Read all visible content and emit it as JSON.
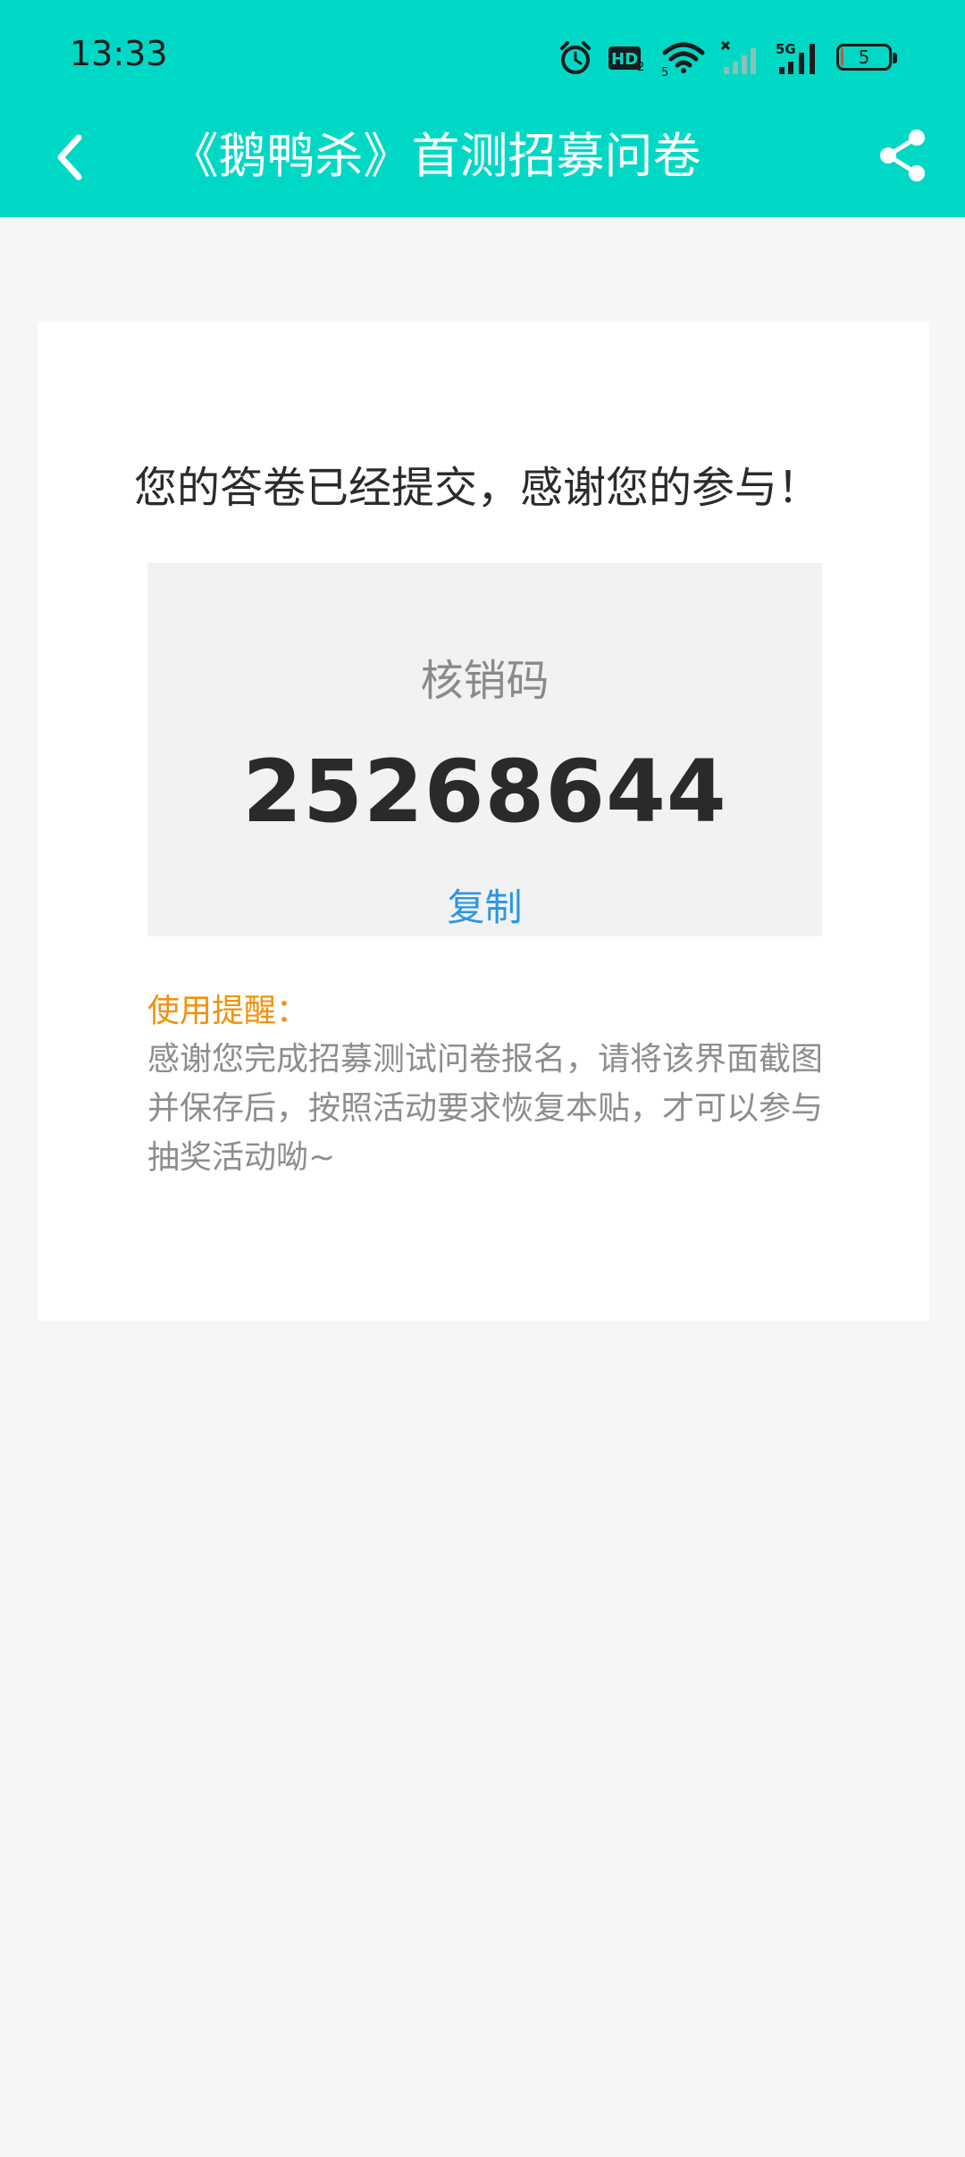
{
  "status_bar": {
    "time": "13:33",
    "icons": [
      "alarm-icon",
      "hd-icon",
      "wifi-icon",
      "signal-icon",
      "5g-signal-icon",
      "battery-icon"
    ],
    "hd_label": "HD",
    "hd_sub": "2",
    "wifi_sub": "5",
    "g5_label": "5G",
    "battery_level": "5",
    "battery_color": "#e04a3a"
  },
  "nav": {
    "title": "《鹅鸭杀》首测招募问卷",
    "back_icon": "chevron-left-icon",
    "share_icon": "share-icon",
    "bg_color": "#00d8c6"
  },
  "content": {
    "success_message": "您的答卷已经提交，感谢您的参与！",
    "code_label": "核销码",
    "code_value": "25268644",
    "copy_label": "复制",
    "reminder_title": "使用提醒：",
    "reminder_text": "感谢您完成招募测试问卷报名，请将该界面截图并保存后，按照活动要求恢复本贴，才可以参与抽奖活动呦~"
  }
}
